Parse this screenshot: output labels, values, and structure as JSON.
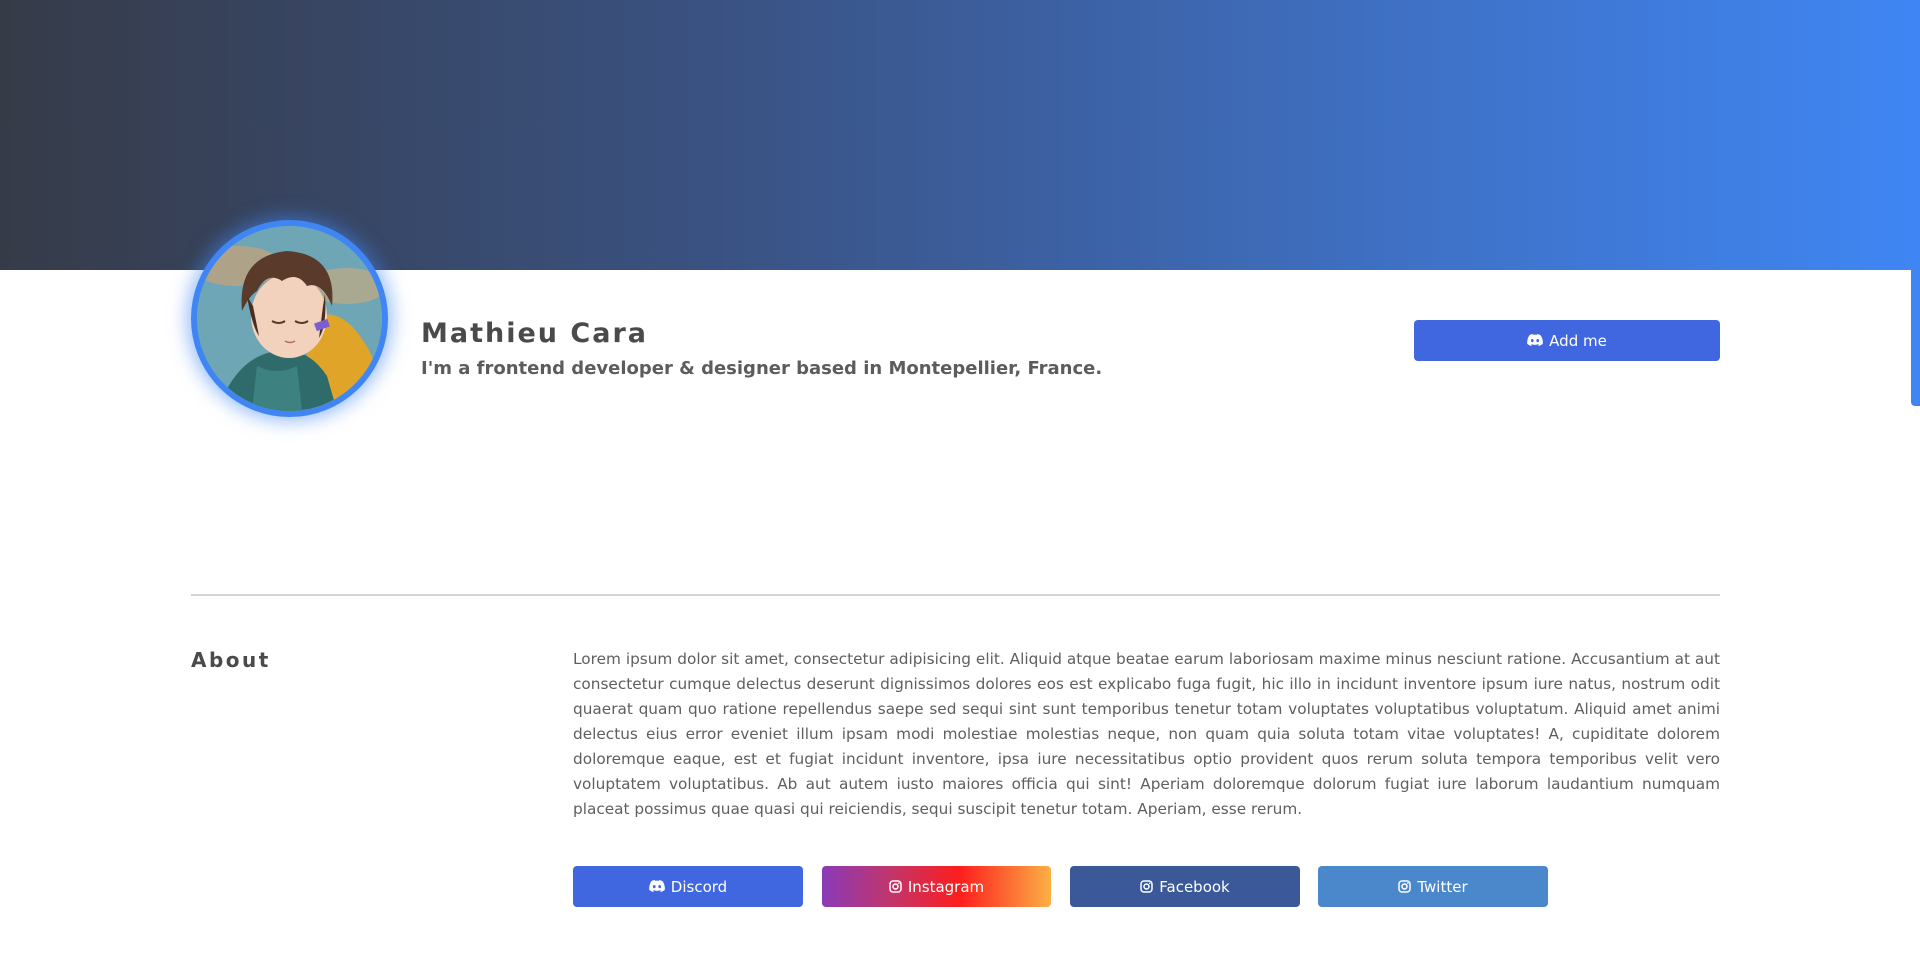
{
  "profile": {
    "name": "Mathieu Cara",
    "bio": "I'm a frontend developer & designer based in Montepellier, France.",
    "add_button_label": "Add me"
  },
  "about": {
    "heading": "About",
    "text": "Lorem ipsum dolor sit amet, consectetur adipisicing elit. Aliquid atque beatae earum laboriosam maxime minus nesciunt ratione. Accusantium at aut consectetur cumque delectus deserunt dignissimos dolores eos est explicabo fuga fugit, hic illo in incidunt inventore ipsum iure natus, nostrum odit quaerat quam quo ratione repellendus saepe sed sequi sint sunt temporibus tenetur totam voluptates voluptatibus voluptatum. Aliquid amet animi delectus eius error eveniet illum ipsam modi molestiae molestias neque, non quam quia soluta totam vitae voluptates! A, cupiditate dolorem doloremque eaque, est et fugiat incidunt inventore, ipsa iure necessitatibus optio provident quos rerum soluta tempora temporibus velit vero voluptatem voluptatibus. Ab aut autem iusto maiores officia qui sint! Aperiam doloremque dolorum fugiat iure laborum laudantium numquam placeat possimus quae quasi qui reiciendis, sequi suscipit tenetur totam. Aperiam, esse rerum."
  },
  "social": [
    {
      "label": "Discord",
      "icon": "discord-icon",
      "color": "#4067e0"
    },
    {
      "label": "Instagram",
      "icon": "instagram-icon",
      "color": "#fd1d1d"
    },
    {
      "label": "Facebook",
      "icon": "instagram-icon",
      "color": "#3b5998"
    },
    {
      "label": "Twitter",
      "icon": "instagram-icon",
      "color": "#4a87cb"
    }
  ],
  "colors": {
    "accent": "#3f86f4",
    "banner_start": "#363b48",
    "banner_end": "#3f86f4",
    "button": "#4067e0"
  }
}
